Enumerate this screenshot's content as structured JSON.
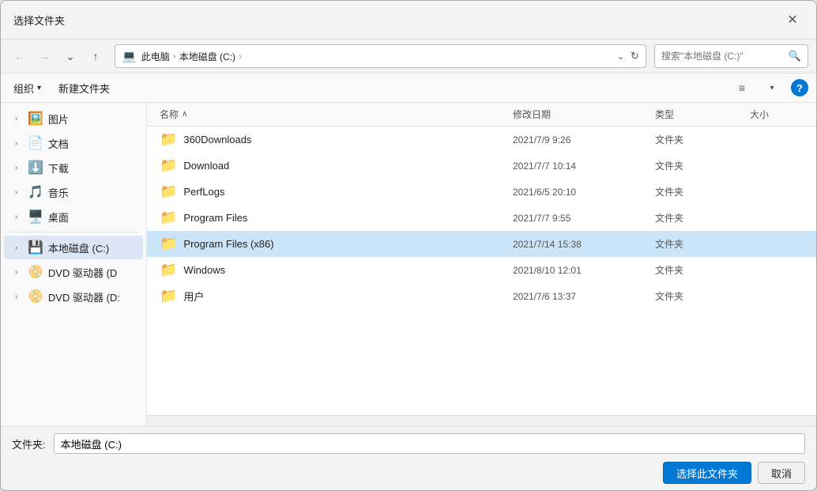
{
  "dialog": {
    "title": "选择文件夹",
    "close_label": "✕"
  },
  "address": {
    "parts": [
      "此电脑",
      "本地磁盘 (C:)"
    ],
    "separator": "›",
    "search_placeholder": "搜索\"本地磁盘 (C:)\""
  },
  "toolbar2": {
    "organize_label": "组织",
    "organize_arrow": "▾",
    "new_folder_label": "新建文件夹",
    "view_icon": "≡",
    "view_arrow": "▾",
    "help_label": "?"
  },
  "file_list": {
    "columns": [
      "名称",
      "修改日期",
      "类型",
      "大小"
    ],
    "sort_col": "名称",
    "sort_arrow": "∧",
    "rows": [
      {
        "name": "360Downloads",
        "date": "2021/7/9 9:26",
        "type": "文件夹",
        "size": "",
        "selected": false
      },
      {
        "name": "Download",
        "date": "2021/7/7 10:14",
        "type": "文件夹",
        "size": "",
        "selected": false
      },
      {
        "name": "PerfLogs",
        "date": "2021/6/5 20:10",
        "type": "文件夹",
        "size": "",
        "selected": false
      },
      {
        "name": "Program Files",
        "date": "2021/7/7 9:55",
        "type": "文件夹",
        "size": "",
        "selected": false
      },
      {
        "name": "Program Files (x86)",
        "date": "2021/7/14 15:38",
        "type": "文件夹",
        "size": "",
        "selected": true
      },
      {
        "name": "Windows",
        "date": "2021/8/10 12:01",
        "type": "文件夹",
        "size": "",
        "selected": false
      },
      {
        "name": "用户",
        "date": "2021/7/6 13:37",
        "type": "文件夹",
        "size": "",
        "selected": false
      }
    ]
  },
  "sidebar": {
    "items": [
      {
        "id": "pictures",
        "label": "图片",
        "icon": "🖼️",
        "expand": "›",
        "active": false
      },
      {
        "id": "documents",
        "label": "文档",
        "icon": "📄",
        "expand": "›",
        "active": false
      },
      {
        "id": "downloads",
        "label": "下载",
        "icon": "⬇️",
        "expand": "›",
        "active": false
      },
      {
        "id": "music",
        "label": "音乐",
        "icon": "🎵",
        "expand": "›",
        "active": false
      },
      {
        "id": "desktop",
        "label": "桌面",
        "icon": "🖥️",
        "expand": "›",
        "active": false
      },
      {
        "id": "local-c",
        "label": "本地磁盘 (C:)",
        "icon": "💾",
        "expand": "›",
        "active": true
      },
      {
        "id": "dvd-d1",
        "label": "DVD 驱动器 (D",
        "icon": "📀",
        "expand": "›",
        "active": false
      },
      {
        "id": "dvd-d2",
        "label": "DVD 驱动器 (D:",
        "icon": "📀",
        "expand": "›",
        "active": false
      }
    ]
  },
  "footer": {
    "folder_label": "文件夹:",
    "folder_value": "本地磁盘 (C:)",
    "select_btn": "选择此文件夹",
    "cancel_btn": "取消"
  }
}
